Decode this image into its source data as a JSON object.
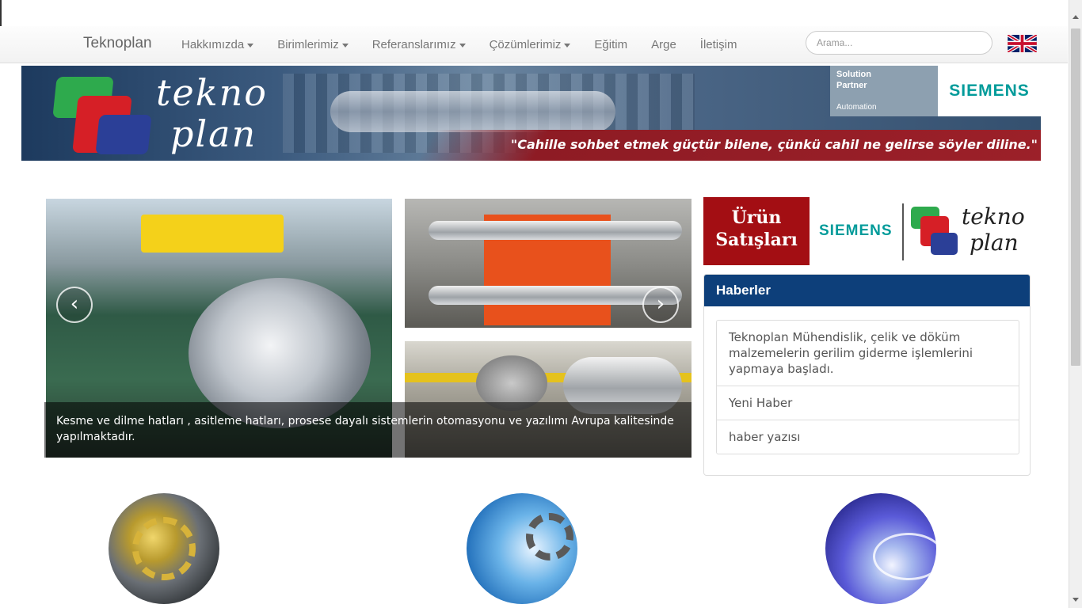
{
  "navbar": {
    "brand": "Teknoplan",
    "items": [
      {
        "label": "Hakkımızda",
        "dropdown": true
      },
      {
        "label": "Birimlerimiz",
        "dropdown": true
      },
      {
        "label": "Referanslarımız",
        "dropdown": true
      },
      {
        "label": "Çözümlerimiz",
        "dropdown": true
      },
      {
        "label": "Eğitim",
        "dropdown": false
      },
      {
        "label": "Arge",
        "dropdown": false
      },
      {
        "label": "İletişim",
        "dropdown": false
      }
    ],
    "search_placeholder": "Arama...",
    "language_flag": "uk-flag-icon"
  },
  "banner": {
    "logo_line1": "tekno",
    "logo_line2": "plan",
    "partner_line1": "Solution",
    "partner_line2": "Partner",
    "partner_line3": "Automation",
    "siemens": "SIEMENS",
    "quote": "\"Cahille sohbet etmek güçtür bilene, çünkü cahil ne gelirse söyler diline.\""
  },
  "carousel": {
    "caption": "Kesme ve dilme hatları , asitleme hatları, prosese dayalı sistemlerin otomasyonu ve yazılımı Avrupa kalitesinde yapılmaktadır.",
    "prev": "‹",
    "next": "›"
  },
  "urun": {
    "line1": "Ürün",
    "line2": "Satışları",
    "siemens": "SIEMENS",
    "logo_line1": "tekno",
    "logo_line2": "plan"
  },
  "news": {
    "title": "Haberler",
    "items": [
      "Teknoplan Mühendislik, çelik ve döküm malzemelerin gerilim giderme işlemlerini yapmaya başladı.",
      "Yeni Haber",
      "haber yazısı"
    ]
  },
  "colors": {
    "nav_blue": "#0d3f7a",
    "siemens_teal": "#019b9a",
    "red": "#a30e13"
  }
}
